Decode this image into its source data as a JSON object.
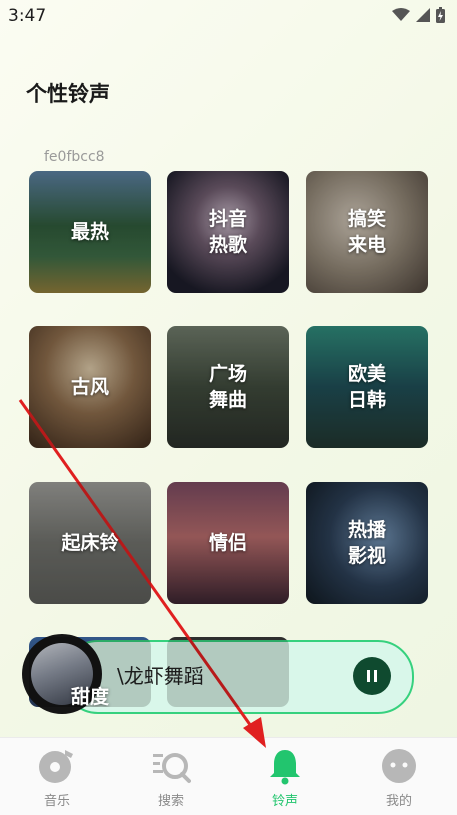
{
  "status": {
    "time": "3:47"
  },
  "page": {
    "title": "个性铃声",
    "hash": "fe0fbcc8"
  },
  "tiles": [
    {
      "label": "最热"
    },
    {
      "label": "抖音\n热歌"
    },
    {
      "label": "搞笑\n来电"
    },
    {
      "label": "古风"
    },
    {
      "label": "广场\n舞曲"
    },
    {
      "label": "欧美\n日韩"
    },
    {
      "label": "起床铃"
    },
    {
      "label": "情侣"
    },
    {
      "label": "热播\n影视"
    },
    {
      "label": "甜度"
    },
    {
      "label": ""
    }
  ],
  "player": {
    "song": "\\龙虾舞蹈"
  },
  "nav": [
    {
      "label": "音乐",
      "icon": "music-disc-icon"
    },
    {
      "label": "搜索",
      "icon": "search-icon"
    },
    {
      "label": "铃声",
      "icon": "bell-icon"
    },
    {
      "label": "我的",
      "icon": "profile-icon"
    }
  ],
  "colors": {
    "accent": "#22c56e",
    "player_bg": "#d9f7ea",
    "pause_bg": "#0f4a2f",
    "arrow": "#e02020"
  }
}
